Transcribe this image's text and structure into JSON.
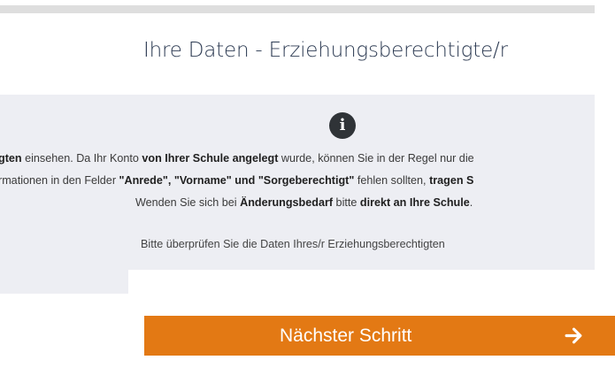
{
  "section": {
    "title": "Ihre Daten - Erziehungsberechtigte/r"
  },
  "info": {
    "icon": "info-icon",
    "icon_glyph": "i",
    "line1": {
      "a": "gten",
      "b": " einsehen. Da Ihr Konto ",
      "c": "von Ihrer Schule angelegt",
      "d": " wurde, können Sie in der Regel nur die"
    },
    "line2": {
      "a": "rmationen in den Felder ",
      "b": "\"Anrede\", \"Vorname\" und \"Sorgeberechtigt\"",
      "c": " fehlen sollten, ",
      "d": "tragen S"
    },
    "line3": {
      "a": "Wenden Sie sich bei ",
      "b": "Änderungsbedarf",
      "c": " bitte ",
      "d": "direkt an Ihre Schule",
      "e": "."
    },
    "line4": "Bitte überprüfen Sie die Daten Ihres/r Erziehungsberechtigten"
  },
  "next_button": {
    "label": "Nächster Schritt",
    "icon": "arrow-right-icon"
  },
  "colors": {
    "button": "#e37914",
    "info_bg": "#edeef3",
    "title": "#2c3a52",
    "icon_bg": "#2f3337"
  }
}
